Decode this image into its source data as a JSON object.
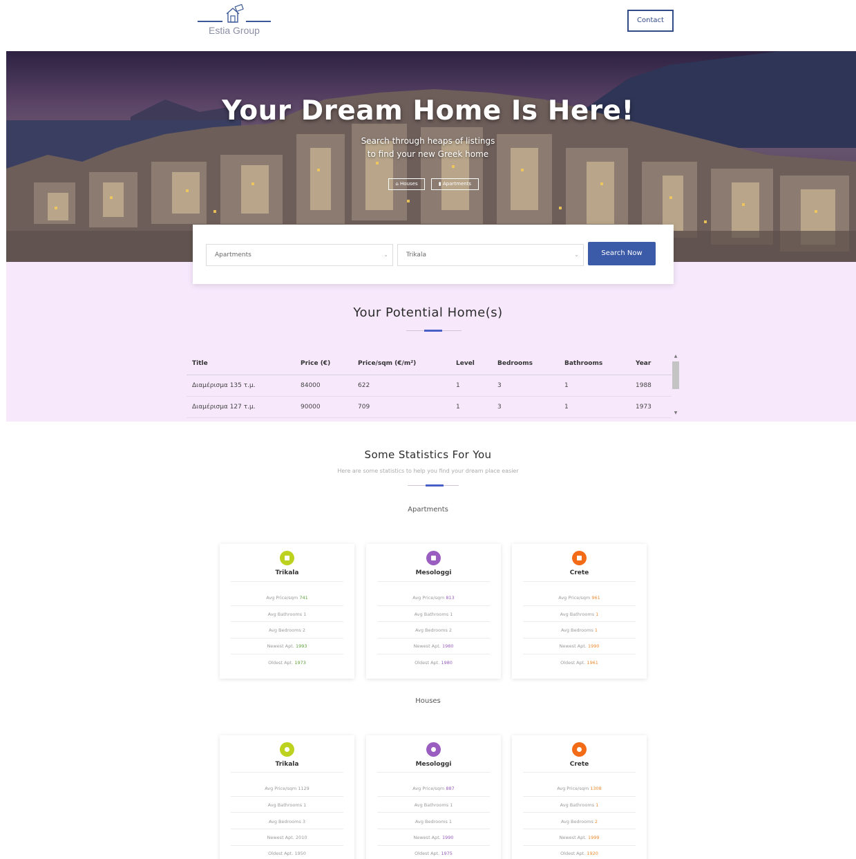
{
  "brand": {
    "name": "Estia Group"
  },
  "nav": {
    "contact_label": "Contact"
  },
  "hero": {
    "title": "Your Dream Home Is Here!",
    "subtitle_line1": "Search through heaps of listings",
    "subtitle_line2": "to find your new Greek home",
    "tab_houses": "Houses",
    "tab_apartments": "Apartments"
  },
  "search": {
    "type_value": "Apartments",
    "city_value": "Trikala",
    "button_label": "Search Now"
  },
  "results": {
    "title": "Your Potential Home(s)",
    "columns": [
      "Title",
      "Price (€)",
      "Price/sqm (€/m²)",
      "Level",
      "Bedrooms",
      "Bathrooms",
      "Year"
    ],
    "rows": [
      [
        "Διαμέρισμα 135 τ.μ.",
        "84000",
        "622",
        "1",
        "3",
        "1",
        "1988"
      ],
      [
        "Διαμέρισμα 127 τ.μ.",
        "90000",
        "709",
        "1",
        "3",
        "1",
        "1973"
      ]
    ]
  },
  "stats": {
    "title": "Some Statistics For You",
    "subtitle": "Here are some statistics to help you find your dream place easier",
    "apartments_label": "Apartments",
    "houses_label": "Houses",
    "labels": {
      "avg_price": "Avg Price/sqm",
      "avg_bath": "Avg Bathrooms",
      "avg_bed": "Avg Bedrooms",
      "newest_apt": "Newest Apt.",
      "oldest_apt": "Oldest Apt."
    },
    "apartments": [
      {
        "city": "Trikala",
        "avg_price": "741",
        "avg_bath": "1",
        "avg_bed": "2",
        "newest": "1993",
        "oldest": "1973"
      },
      {
        "city": "Mesologgi",
        "avg_price": "813",
        "avg_bath": "1",
        "avg_bed": "2",
        "newest": "1980",
        "oldest": "1980"
      },
      {
        "city": "Crete",
        "avg_price": "961",
        "avg_bath": "1",
        "avg_bed": "1",
        "newest": "1990",
        "oldest": "1961"
      }
    ],
    "houses": [
      {
        "city": "Trikala",
        "avg_price": "1129",
        "avg_bath": "1",
        "avg_bed": "3",
        "newest": "2010",
        "oldest": "1950"
      },
      {
        "city": "Mesologgi",
        "avg_price": "887",
        "avg_bath": "1",
        "avg_bed": "1",
        "newest": "1990",
        "oldest": "1975"
      },
      {
        "city": "Crete",
        "avg_price": "1308",
        "avg_bath": "1",
        "avg_bed": "2",
        "newest": "1999",
        "oldest": "1920"
      }
    ],
    "accent_colors": [
      "#bcd21e",
      "#9a5ec0",
      "#f46b17"
    ]
  }
}
